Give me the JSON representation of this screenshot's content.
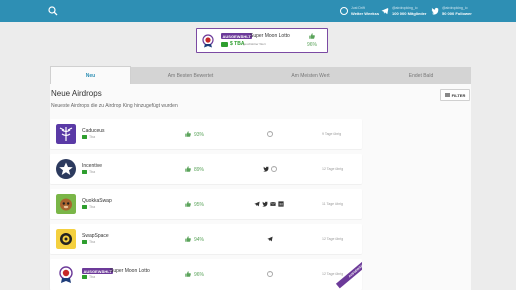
{
  "topbar": {
    "search_icon": "search-icon",
    "stats": [
      {
        "small": "Just Drift",
        "big": "Weiter Weekss",
        "icon": "user-icon"
      },
      {
        "small": "@airdropking_io",
        "big": "100 000 Mitglieder",
        "icon": "telegram-icon"
      },
      {
        "small": "@airdropking_io",
        "big": "50 000 Follower",
        "icon": "twitter-icon"
      }
    ]
  },
  "featured": {
    "badge": "AUSGEWÄHLT",
    "title": "Super Moon Lotto",
    "token": "$ TBA",
    "estimate": "geschätzter Wert",
    "rating": "96%"
  },
  "tabs": [
    {
      "label": "Neu"
    },
    {
      "label": "Am Besten Bewertet"
    },
    {
      "label": "Am Meisten Wert"
    },
    {
      "label": "Endet Bald"
    }
  ],
  "section": {
    "title": "Neue Airdrops",
    "subtitle": "Neueste Airdrops die zu Airdrop King hinzugefügt wurden",
    "filter_label": "FILTER"
  },
  "rows": [
    {
      "name": "Caduceus",
      "token": "Tba",
      "rating": "93%",
      "days": "9 Tage übrig"
    },
    {
      "name": "Incentive",
      "token": "Tba",
      "rating": "89%",
      "days": "12 Tage übrig"
    },
    {
      "name": "QuokkaSwap",
      "token": "Tba",
      "rating": "95%",
      "days": "11 Tage übrig"
    },
    {
      "name": "SwapSpace",
      "token": "Tba",
      "rating": "94%",
      "days": "12 Tage übrig"
    },
    {
      "name": "Super Moon Lotto",
      "badge": "AUSGEWÄHLT",
      "token": "Tba",
      "rating": "96%",
      "days": "12 Tage übrig",
      "ribbon": "AUSGEWÄHLT"
    }
  ],
  "colors": {
    "topbar": "#2e8fb4",
    "accent": "#2e8fb4",
    "featured": "#6c3a99",
    "positive": "#5aa35a"
  }
}
